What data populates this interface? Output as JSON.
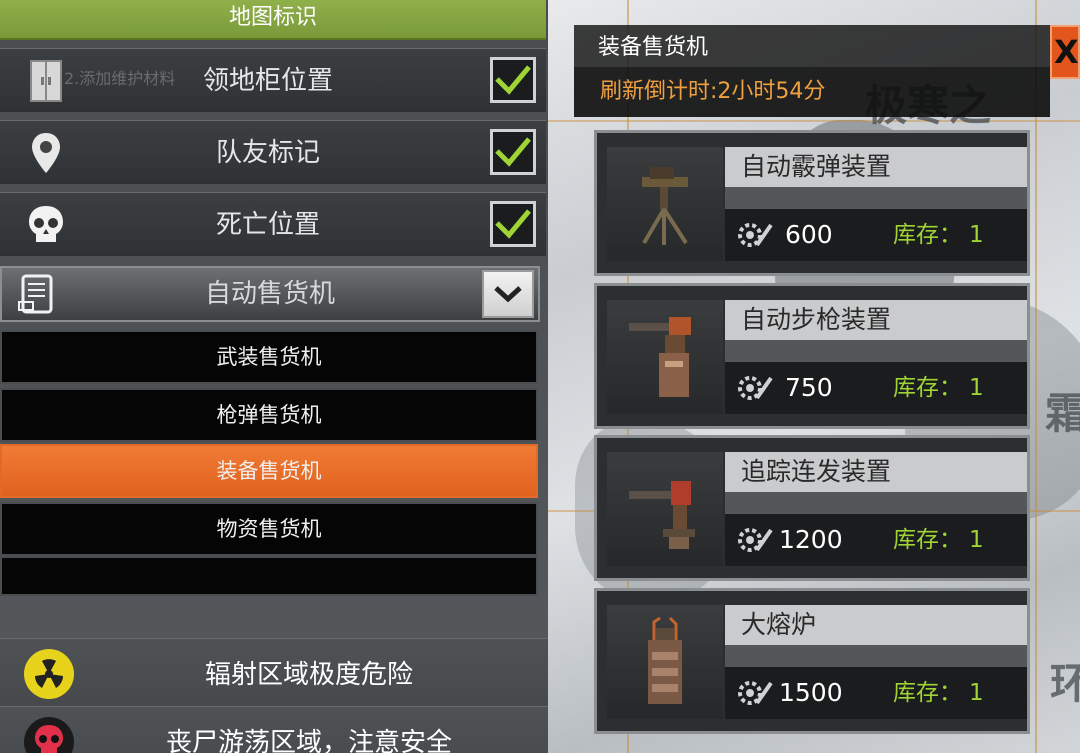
{
  "map": {
    "glyphs": [
      "极寒之",
      "霜",
      "环"
    ]
  },
  "left_panel": {
    "header": "地图标识",
    "hint": "2.添加维护材料",
    "toggles": [
      {
        "label": "领地柜位置",
        "checked": true,
        "icon": "cabinet-icon"
      },
      {
        "label": "队友标记",
        "checked": true,
        "icon": "location-pin-icon"
      },
      {
        "label": "死亡位置",
        "checked": true,
        "icon": "skull-icon"
      }
    ],
    "dropdown": {
      "label": "自动售货机",
      "icon": "vending-machine-icon",
      "options": [
        "武装售货机",
        "枪弹售货机",
        "装备售货机",
        "物资售货机"
      ],
      "selected": "装备售货机"
    },
    "warnings": [
      {
        "label": "辐射区域极度危险",
        "icon": "radiation-icon"
      },
      {
        "label": "丧尸游荡区域，注意安全",
        "icon": "zombie-skull-icon"
      }
    ]
  },
  "shop": {
    "title": "装备售货机",
    "timer": "刷新倒计时:2小时54分",
    "close_label": "X",
    "stock_label": "库存：",
    "items": [
      {
        "name": "自动霰弹装置",
        "price": "600",
        "stock": "1",
        "icon": "auto-shotgun-turret-icon"
      },
      {
        "name": "自动步枪装置",
        "price": "750",
        "stock": "1",
        "icon": "auto-rifle-turret-icon"
      },
      {
        "name": "追踪连发装置",
        "price": "1200",
        "stock": "1",
        "icon": "tracking-burst-turret-icon"
      },
      {
        "name": "大熔炉",
        "price": "1500",
        "stock": "1",
        "icon": "furnace-icon"
      }
    ]
  },
  "colors": {
    "header_green": "#8fb04a",
    "active_orange": "#e8692a",
    "timer_orange": "#f0a040",
    "stock_green": "#9fd336",
    "close_red": "#e2551c"
  }
}
